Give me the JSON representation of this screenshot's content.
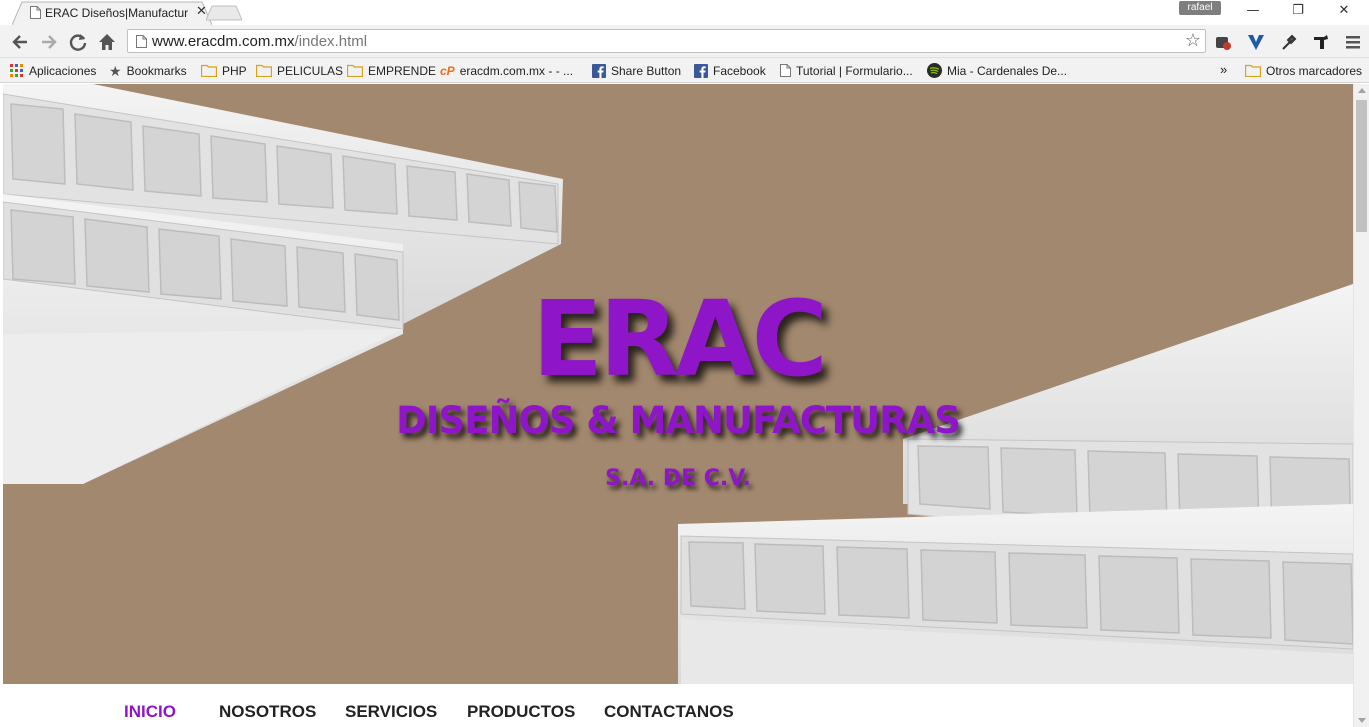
{
  "browser": {
    "tab": {
      "title": "ERAC Diseños|Manufactur",
      "close": "✕"
    },
    "user": "rafael",
    "window": {
      "minimize": "—",
      "restore": "❐",
      "close": "✕"
    },
    "address": {
      "host": "www.eracdm.com.mx",
      "path": "/index.html"
    },
    "bookmarks": [
      {
        "label": "Aplicaciones",
        "icon": "apps-grid-icon"
      },
      {
        "label": "Bookmarks",
        "icon": "star-icon"
      },
      {
        "label": "PHP",
        "icon": "folder-icon"
      },
      {
        "label": "PELICULAS",
        "icon": "folder-icon"
      },
      {
        "label": "EMPRENDE",
        "icon": "folder-icon"
      },
      {
        "label": "eracdm.com.mx - - ...",
        "icon": "cpanel-icon"
      },
      {
        "label": "Share Button",
        "icon": "facebook-icon"
      },
      {
        "label": "Facebook",
        "icon": "facebook-icon"
      },
      {
        "label": "Tutorial | Formulario...",
        "icon": "page-icon"
      },
      {
        "label": "Mia - Cardenales De...",
        "icon": "spotify-icon"
      }
    ],
    "overflow": "»",
    "other_bookmarks": "Otros marcadores"
  },
  "hero": {
    "brand": "ERAC",
    "subtitle": "DISEÑOS & MANUFACTURAS",
    "legal": "S.A. DE C.V."
  },
  "nav": [
    {
      "label": "INICIO",
      "active": true
    },
    {
      "label": "NOSOTROS",
      "active": false
    },
    {
      "label": "SERVICIOS",
      "active": false
    },
    {
      "label": "PRODUCTOS",
      "active": false
    },
    {
      "label": "CONTACTANOS",
      "active": false
    }
  ],
  "colors": {
    "accent": "#8e15c8",
    "hero_bg": "#a2886e"
  }
}
